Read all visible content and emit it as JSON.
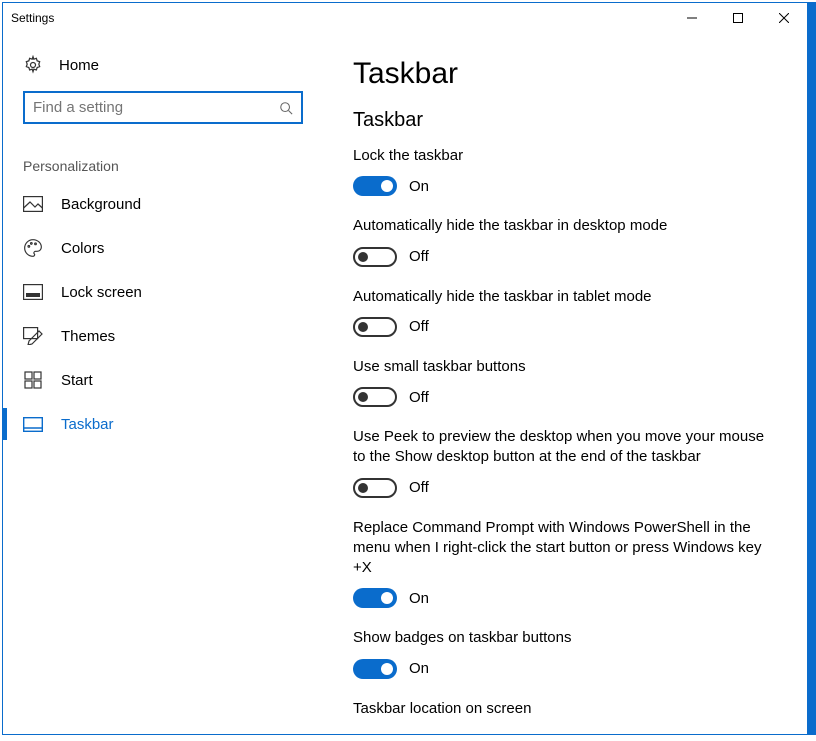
{
  "window": {
    "title": "Settings"
  },
  "sidebar": {
    "home_label": "Home",
    "search_placeholder": "Find a setting",
    "section_title": "Personalization",
    "items": [
      {
        "label": "Background"
      },
      {
        "label": "Colors"
      },
      {
        "label": "Lock screen"
      },
      {
        "label": "Themes"
      },
      {
        "label": "Start"
      },
      {
        "label": "Taskbar"
      }
    ]
  },
  "main": {
    "title": "Taskbar",
    "subheading": "Taskbar",
    "settings": [
      {
        "label": "Lock the taskbar",
        "state": "On"
      },
      {
        "label": "Automatically hide the taskbar in desktop mode",
        "state": "Off"
      },
      {
        "label": "Automatically hide the taskbar in tablet mode",
        "state": "Off"
      },
      {
        "label": "Use small taskbar buttons",
        "state": "Off"
      },
      {
        "label": "Use Peek to preview the desktop when you move your mouse to the Show desktop button at the end of the taskbar",
        "state": "Off"
      },
      {
        "label": "Replace Command Prompt with Windows PowerShell in the menu when I right-click the start button or press Windows key +X",
        "state": "On"
      },
      {
        "label": "Show badges on taskbar buttons",
        "state": "On"
      },
      {
        "label": "Taskbar location on screen",
        "state": ""
      }
    ]
  }
}
